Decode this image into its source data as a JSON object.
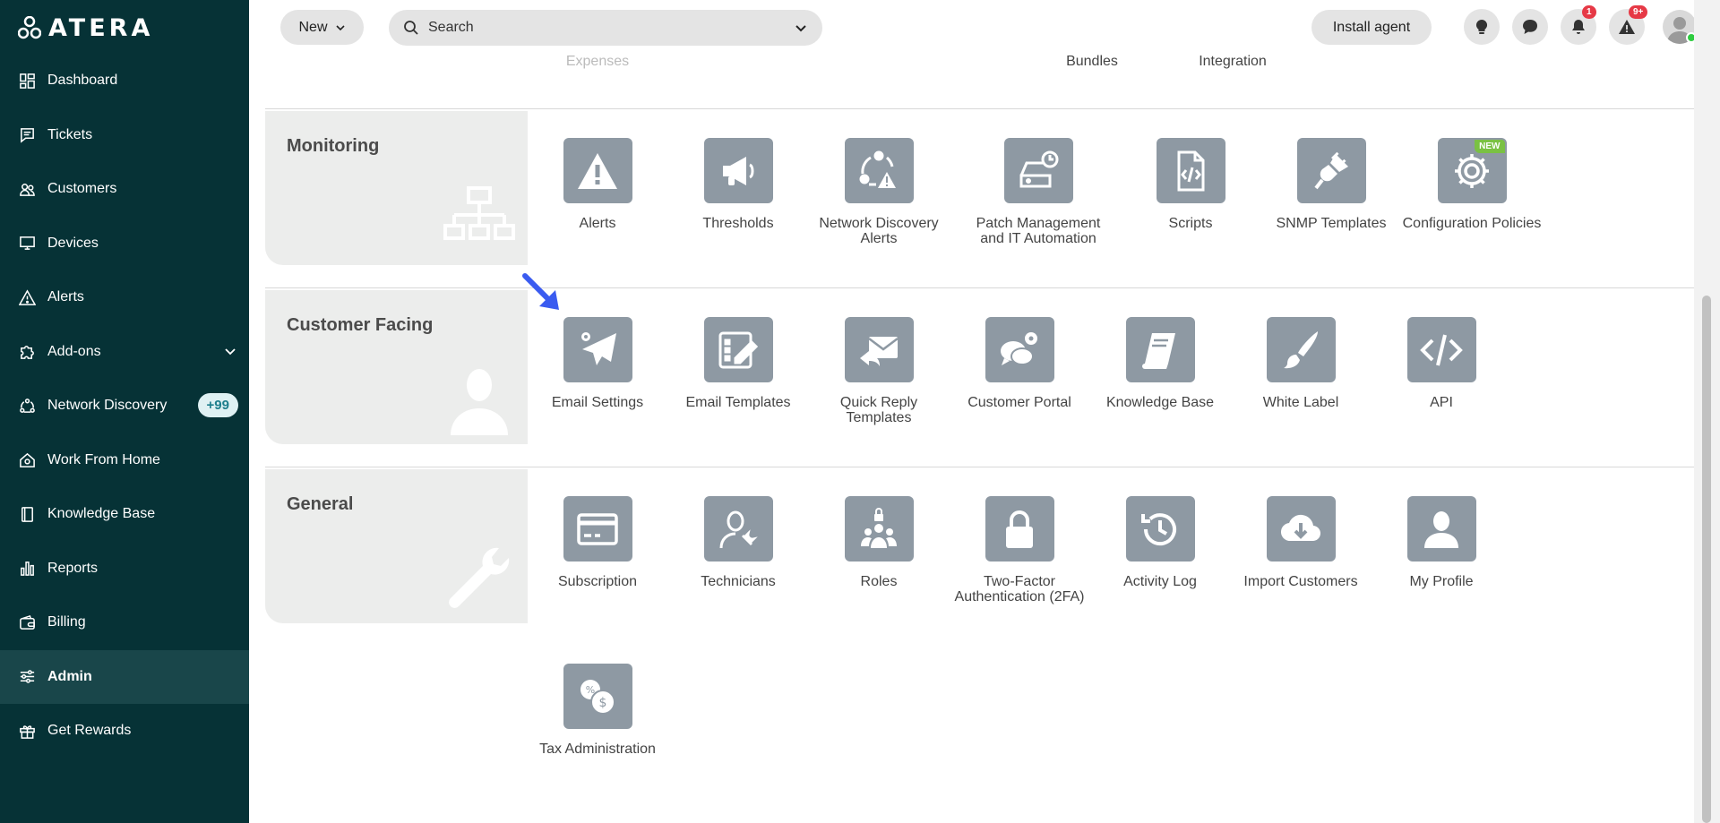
{
  "brand": {
    "logo_text": "ATERA"
  },
  "sidebar": {
    "items": [
      {
        "label": "Dashboard",
        "icon": "dashboard-icon"
      },
      {
        "label": "Tickets",
        "icon": "ticket-icon"
      },
      {
        "label": "Customers",
        "icon": "customers-icon"
      },
      {
        "label": "Devices",
        "icon": "monitor-icon"
      },
      {
        "label": "Alerts",
        "icon": "alert-triangle-icon"
      },
      {
        "label": "Add-ons",
        "icon": "puzzle-icon"
      },
      {
        "label": "Network Discovery",
        "icon": "network-icon",
        "badge": "+99"
      },
      {
        "label": "Work From Home",
        "icon": "home-icon"
      },
      {
        "label": "Knowledge Base",
        "icon": "book-icon"
      },
      {
        "label": "Reports",
        "icon": "bar-chart-icon"
      },
      {
        "label": "Billing",
        "icon": "wallet-icon"
      },
      {
        "label": "Admin",
        "icon": "sliders-icon",
        "active": true
      },
      {
        "label": "Get Rewards",
        "icon": "gift-icon"
      }
    ]
  },
  "topbar": {
    "new_label": "New",
    "search_placeholder": "Search",
    "install_label": "Install agent",
    "notifications_badge": "1",
    "alerts_badge": "9+"
  },
  "partial_row": {
    "labels": [
      "Expenses",
      "Bundles",
      "Integration"
    ]
  },
  "sections": {
    "monitoring": {
      "title": "Monitoring",
      "tiles": [
        "Alerts",
        "Thresholds",
        "Network Discovery Alerts",
        "Patch Management and IT Automation",
        "Scripts",
        "SNMP Templates",
        "Configuration Policies"
      ],
      "new_badge": "NEW"
    },
    "customer_facing": {
      "title": "Customer Facing",
      "tiles": [
        "Email Settings",
        "Email Templates",
        "Quick Reply Templates",
        "Customer Portal",
        "Knowledge Base",
        "White Label",
        "API"
      ]
    },
    "general": {
      "title": "General",
      "tiles": [
        "Subscription",
        "Technicians",
        "Roles",
        "Two-Factor Authentication (2FA)",
        "Activity Log",
        "Import Customers",
        "My Profile",
        "Tax Administration"
      ]
    }
  }
}
